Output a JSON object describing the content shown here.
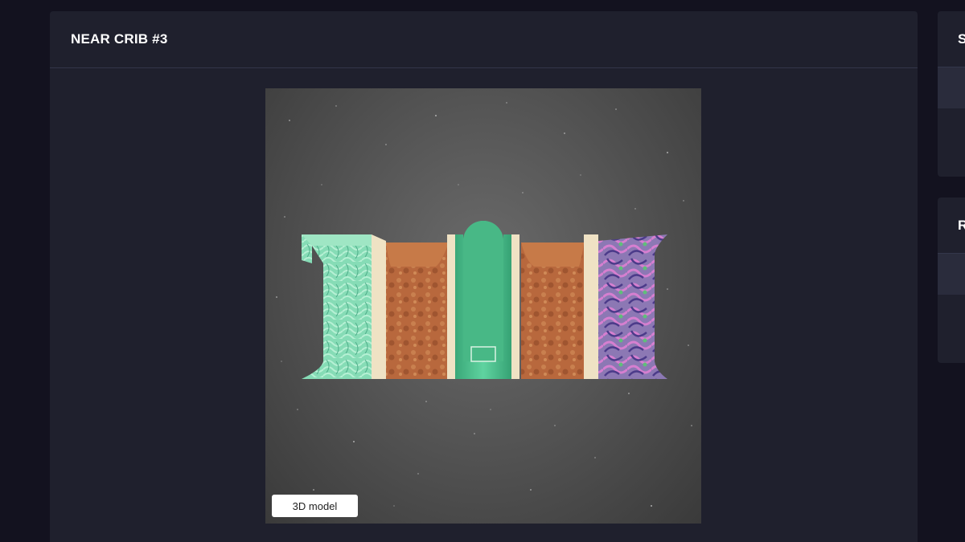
{
  "main": {
    "title": "NEAR CRIB #3",
    "viewer_button_label": "3D model"
  },
  "side_panels": [
    {
      "title_fragment": "S"
    },
    {
      "title_fragment": "R"
    }
  ],
  "colors": {
    "page_bg": "#13121f",
    "card_bg": "#1f202d",
    "divider": "#33364a",
    "viewer_bg": "#575757",
    "mint": "#7fd6b0",
    "copper": "#b7663c",
    "jade": "#3fbf8a",
    "purple": "#8e6ab8"
  }
}
